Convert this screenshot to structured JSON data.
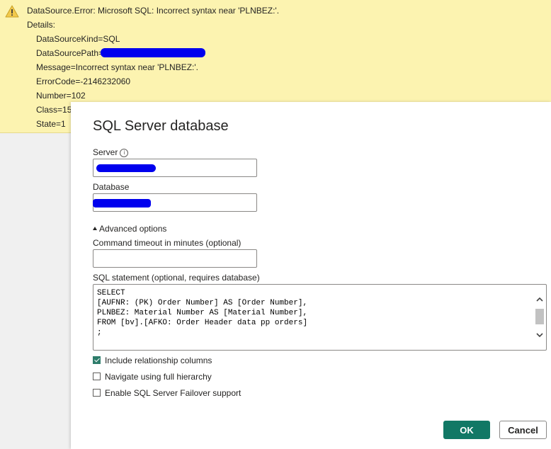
{
  "error": {
    "title": "DataSource.Error: Microsoft SQL: Incorrect syntax near 'PLNBEZ:'.",
    "details_label": "Details:",
    "lines": [
      "DataSourceKind=SQL",
      "DataSourcePath=",
      "Message=Incorrect syntax near 'PLNBEZ:'.",
      "ErrorCode=-2146232060",
      "Number=102",
      "Class=15",
      "State=1"
    ]
  },
  "dialog": {
    "title": "SQL Server database",
    "server_label": "Server",
    "server_value": "",
    "database_label": "Database",
    "database_value": "",
    "advanced_label": "Advanced options",
    "timeout_label": "Command timeout in minutes (optional)",
    "timeout_value": "",
    "sql_label": "SQL statement (optional, requires database)",
    "sql_text": "SELECT\n[AUFNR: (PK) Order Number] AS [Order Number],\nPLNBEZ: Material Number AS [Material Number],\nFROM [bv].[AFKO: Order Header data pp orders]\n;",
    "checkboxes": [
      {
        "label": "Include relationship columns",
        "checked": true
      },
      {
        "label": "Navigate using full hierarchy",
        "checked": false
      },
      {
        "label": "Enable SQL Server Failover support",
        "checked": false
      }
    ],
    "ok_label": "OK",
    "cancel_label": "Cancel"
  },
  "colors": {
    "banner": "#fcf3b0",
    "redaction": "#0000ee",
    "primary_button": "#117865"
  }
}
